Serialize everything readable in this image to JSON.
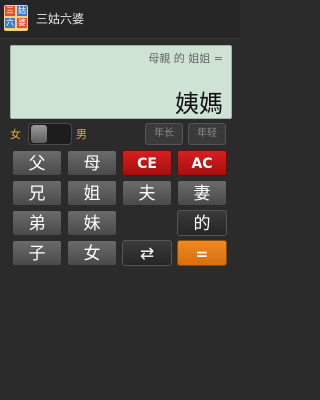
{
  "app": {
    "title": "三姑六婆",
    "icon_cells": [
      "三",
      "姑",
      "六",
      "婆"
    ]
  },
  "display": {
    "expression": "母親 的 姐姐 =",
    "result": "姨媽"
  },
  "gender": {
    "female_label": "女",
    "male_label": "男",
    "selected": "女"
  },
  "age": {
    "older_label": "年长",
    "younger_label": "年轻"
  },
  "keys": {
    "father": "父",
    "mother": "母",
    "ce": "CE",
    "ac": "AC",
    "elder_brother": "兄",
    "elder_sister": "姐",
    "husband": "夫",
    "wife": "妻",
    "younger_brother": "弟",
    "younger_sister": "妹",
    "of": "的",
    "son": "子",
    "daughter": "女",
    "swap": "⇄",
    "equals": "="
  },
  "colors": {
    "display_bg": "#cfe3d5",
    "accent_red": "#c41414",
    "accent_orange": "#f08a20",
    "label_gold": "#e0b13a"
  }
}
